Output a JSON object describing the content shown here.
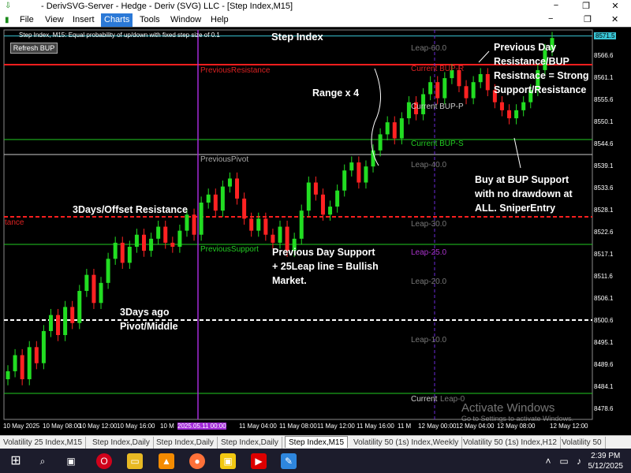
{
  "window": {
    "title": "- DerivSVG-Server - Hedge - Deriv (SVG) LLC - [Step Index,M15]",
    "minimize": "−",
    "restore": "❐",
    "close": "✕"
  },
  "menu": {
    "file": "File",
    "view": "View",
    "insert": "Insert",
    "charts": "Charts",
    "tools": "Tools",
    "window": "Window",
    "help": "Help"
  },
  "chart": {
    "header": "Step Index, M15:  Equal probability of up/down with fixed step size of 0.1",
    "title": "Step Index",
    "refresh_button": "Refresh BUP",
    "levels": {
      "leap60": "Leap-60.0",
      "leap40": "Leap-40.0",
      "leap30": "Leap-30.0",
      "leap25": "Leap-25.0",
      "leap20": "Leap-20.0",
      "leap10": "Leap-10.0",
      "leap0": "Leap-0",
      "current_bup_r": "Current BUP-R",
      "current_bup_p": "Current BUP-P",
      "current_bup_s": "Current BUP-S",
      "current_bup_0": "Current",
      "previous_resistance": "PreviousResistance",
      "previous_pivot": "PreviousPivot",
      "previous_support": "PreviousSupport",
      "resistance_left": "tance"
    },
    "annotations": {
      "range": "Range x 4",
      "prev_day_res": [
        "Previous Day",
        "Resistance/BUP",
        "Resistnace = Strong",
        "Support/Resistance"
      ],
      "buy": [
        "Buy at BUP Support",
        "with no drawdown at",
        "ALL. SniperEntry"
      ],
      "offset": "3Days/Offset Resistance",
      "prev_support": [
        "Previous Day Support",
        "+ 25Leap line = Bullish",
        "Market."
      ],
      "pivot3": [
        "3Days ago",
        "Pivot/Middle"
      ]
    },
    "prices": [
      "8571.5",
      "8566.6",
      "8561.1",
      "8555.6",
      "8550.1",
      "8544.6",
      "8539.1",
      "8533.6",
      "8528.1",
      "8522.6",
      "8517.1",
      "8511.6",
      "8506.1",
      "8500.6",
      "8495.1",
      "8489.6",
      "8484.1",
      "8478.6"
    ],
    "time_labels": [
      "10 May 2025",
      "10 May 08:00",
      "10 May 12:00",
      "10 May 16:00",
      "10 M",
      "2025.05.11 00:00",
      "11 May 04:00",
      "11 May 08:00",
      "11 May 12:00",
      "11 May 16:00",
      "11 M",
      "12 May 00:00",
      "12 May 04:00",
      "12 May 08:00",
      "12 May 12:00"
    ]
  },
  "tabs": [
    "Volatility 25 Index,M15",
    "Step Index,Daily",
    "Step Index,Daily",
    "Step Index,Daily",
    "Step Index,M15",
    "Volatility 50 (1s) Index,Weekly",
    "Volatility 50 (1s) Index,H12",
    "Volatility 50"
  ],
  "watermark": {
    "line1": "Activate Windows",
    "line2": "Go to Settings to activate Windows."
  },
  "clock": {
    "time": "2:39 PM",
    "date": "5/12/2025"
  },
  "chart_data": {
    "type": "candlestick",
    "title": "Step Index",
    "series": [
      {
        "name": "Step Index, M15",
        "close": [
          8488,
          8492,
          8486,
          8494,
          8490,
          8498,
          8502,
          8497,
          8504,
          8500,
          8508,
          8512,
          8505,
          8510,
          8516,
          8520,
          8515,
          8519,
          8522,
          8518,
          8521,
          8524,
          8520,
          8519,
          8523,
          8527,
          8522,
          8530,
          8532,
          8528,
          8534,
          8536,
          8531,
          8526,
          8523,
          8526,
          8522,
          8520,
          8524,
          8518,
          8521,
          8528,
          8535,
          8532,
          8527,
          8529,
          8533,
          8538,
          8540,
          8535,
          8539,
          8543,
          8547,
          8550,
          8546,
          8551,
          8555,
          8552,
          8557,
          8560,
          8556,
          8561,
          8563,
          8559,
          8556,
          8560,
          8562,
          8558,
          8555,
          8553,
          8551,
          8553,
          8555,
          8558,
          8563,
          8568,
          8571
        ]
      }
    ],
    "ylim": [
      8476,
      8573
    ]
  }
}
